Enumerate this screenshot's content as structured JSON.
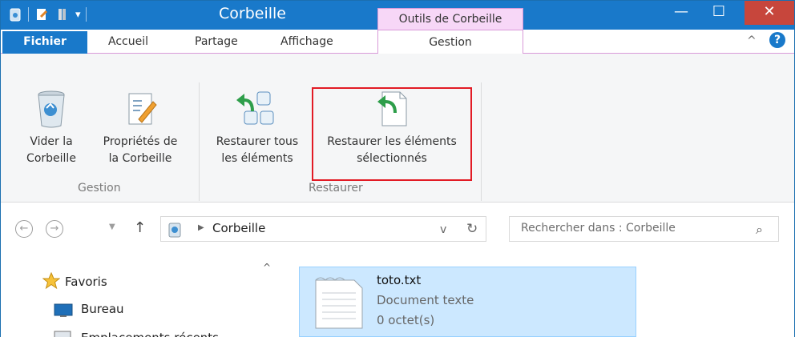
{
  "window": {
    "title": "Corbeille",
    "context_tab": "Outils de Corbeille",
    "controls": {
      "minimize": "—",
      "maximize": "☐",
      "close": "✕"
    }
  },
  "tabs": {
    "file": "Fichier",
    "home": "Accueil",
    "share": "Partage",
    "view": "Affichage",
    "manage": "Gestion"
  },
  "ribbon": {
    "empty_bin": {
      "line1": "Vider la",
      "line2": "Corbeille"
    },
    "bin_properties": {
      "line1": "Propriétés de",
      "line2": "la Corbeille"
    },
    "group_manage": "Gestion",
    "restore_all": {
      "line1": "Restaurer tous",
      "line2": "les éléments"
    },
    "restore_selected": {
      "line1": "Restaurer les éléments",
      "line2": "sélectionnés"
    },
    "group_restore": "Restaurer"
  },
  "address": {
    "path": "Corbeille",
    "search_placeholder": "Rechercher dans : Corbeille"
  },
  "nav_pane": {
    "favorites": "Favoris",
    "desktop": "Bureau",
    "recent": "Emplacements récents"
  },
  "file": {
    "name": "toto.txt",
    "type": "Document texte",
    "size": "0 octet(s)"
  },
  "colors": {
    "titlebar": "#1979ca",
    "close": "#c7463c",
    "context_tab": "#f7d7f7",
    "highlight_border": "#e21b25",
    "selection": "#cce8ff"
  }
}
